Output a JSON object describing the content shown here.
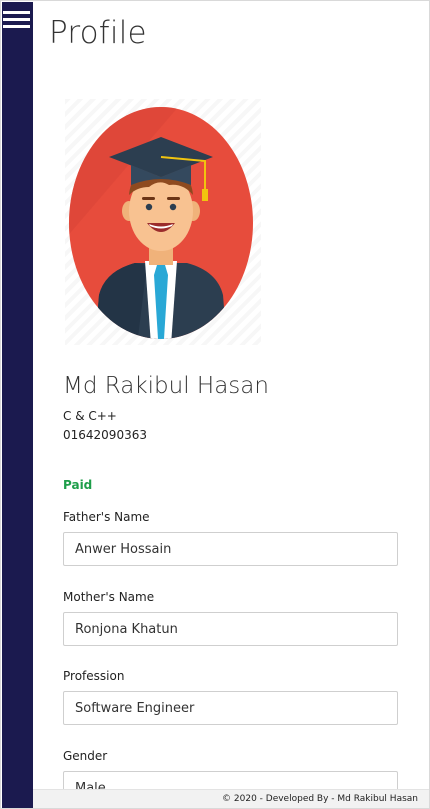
{
  "header": {
    "menu_icon": "hamburger-menu-icon",
    "title": "Profile"
  },
  "profile": {
    "avatar_icon": "graduate-avatar-icon",
    "name": "Md Rakibul Hasan",
    "course": "C & C++",
    "phone": "01642090363",
    "payment_status": "Paid"
  },
  "fields": {
    "father": {
      "label": "Father's Name",
      "value": "Anwer Hossain"
    },
    "mother": {
      "label": "Mother's Name",
      "value": "Ronjona Khatun"
    },
    "profession": {
      "label": "Profession",
      "value": "Software Engineer"
    },
    "gender": {
      "label": "Gender",
      "value": "Male"
    }
  },
  "footer": {
    "text": "© 2020 - Developed By - Md Rakibul Hasan"
  },
  "colors": {
    "sidebar": "#1b1a4f",
    "paid": "#1e9e4a",
    "avatar_bg": "#e74c3c"
  }
}
